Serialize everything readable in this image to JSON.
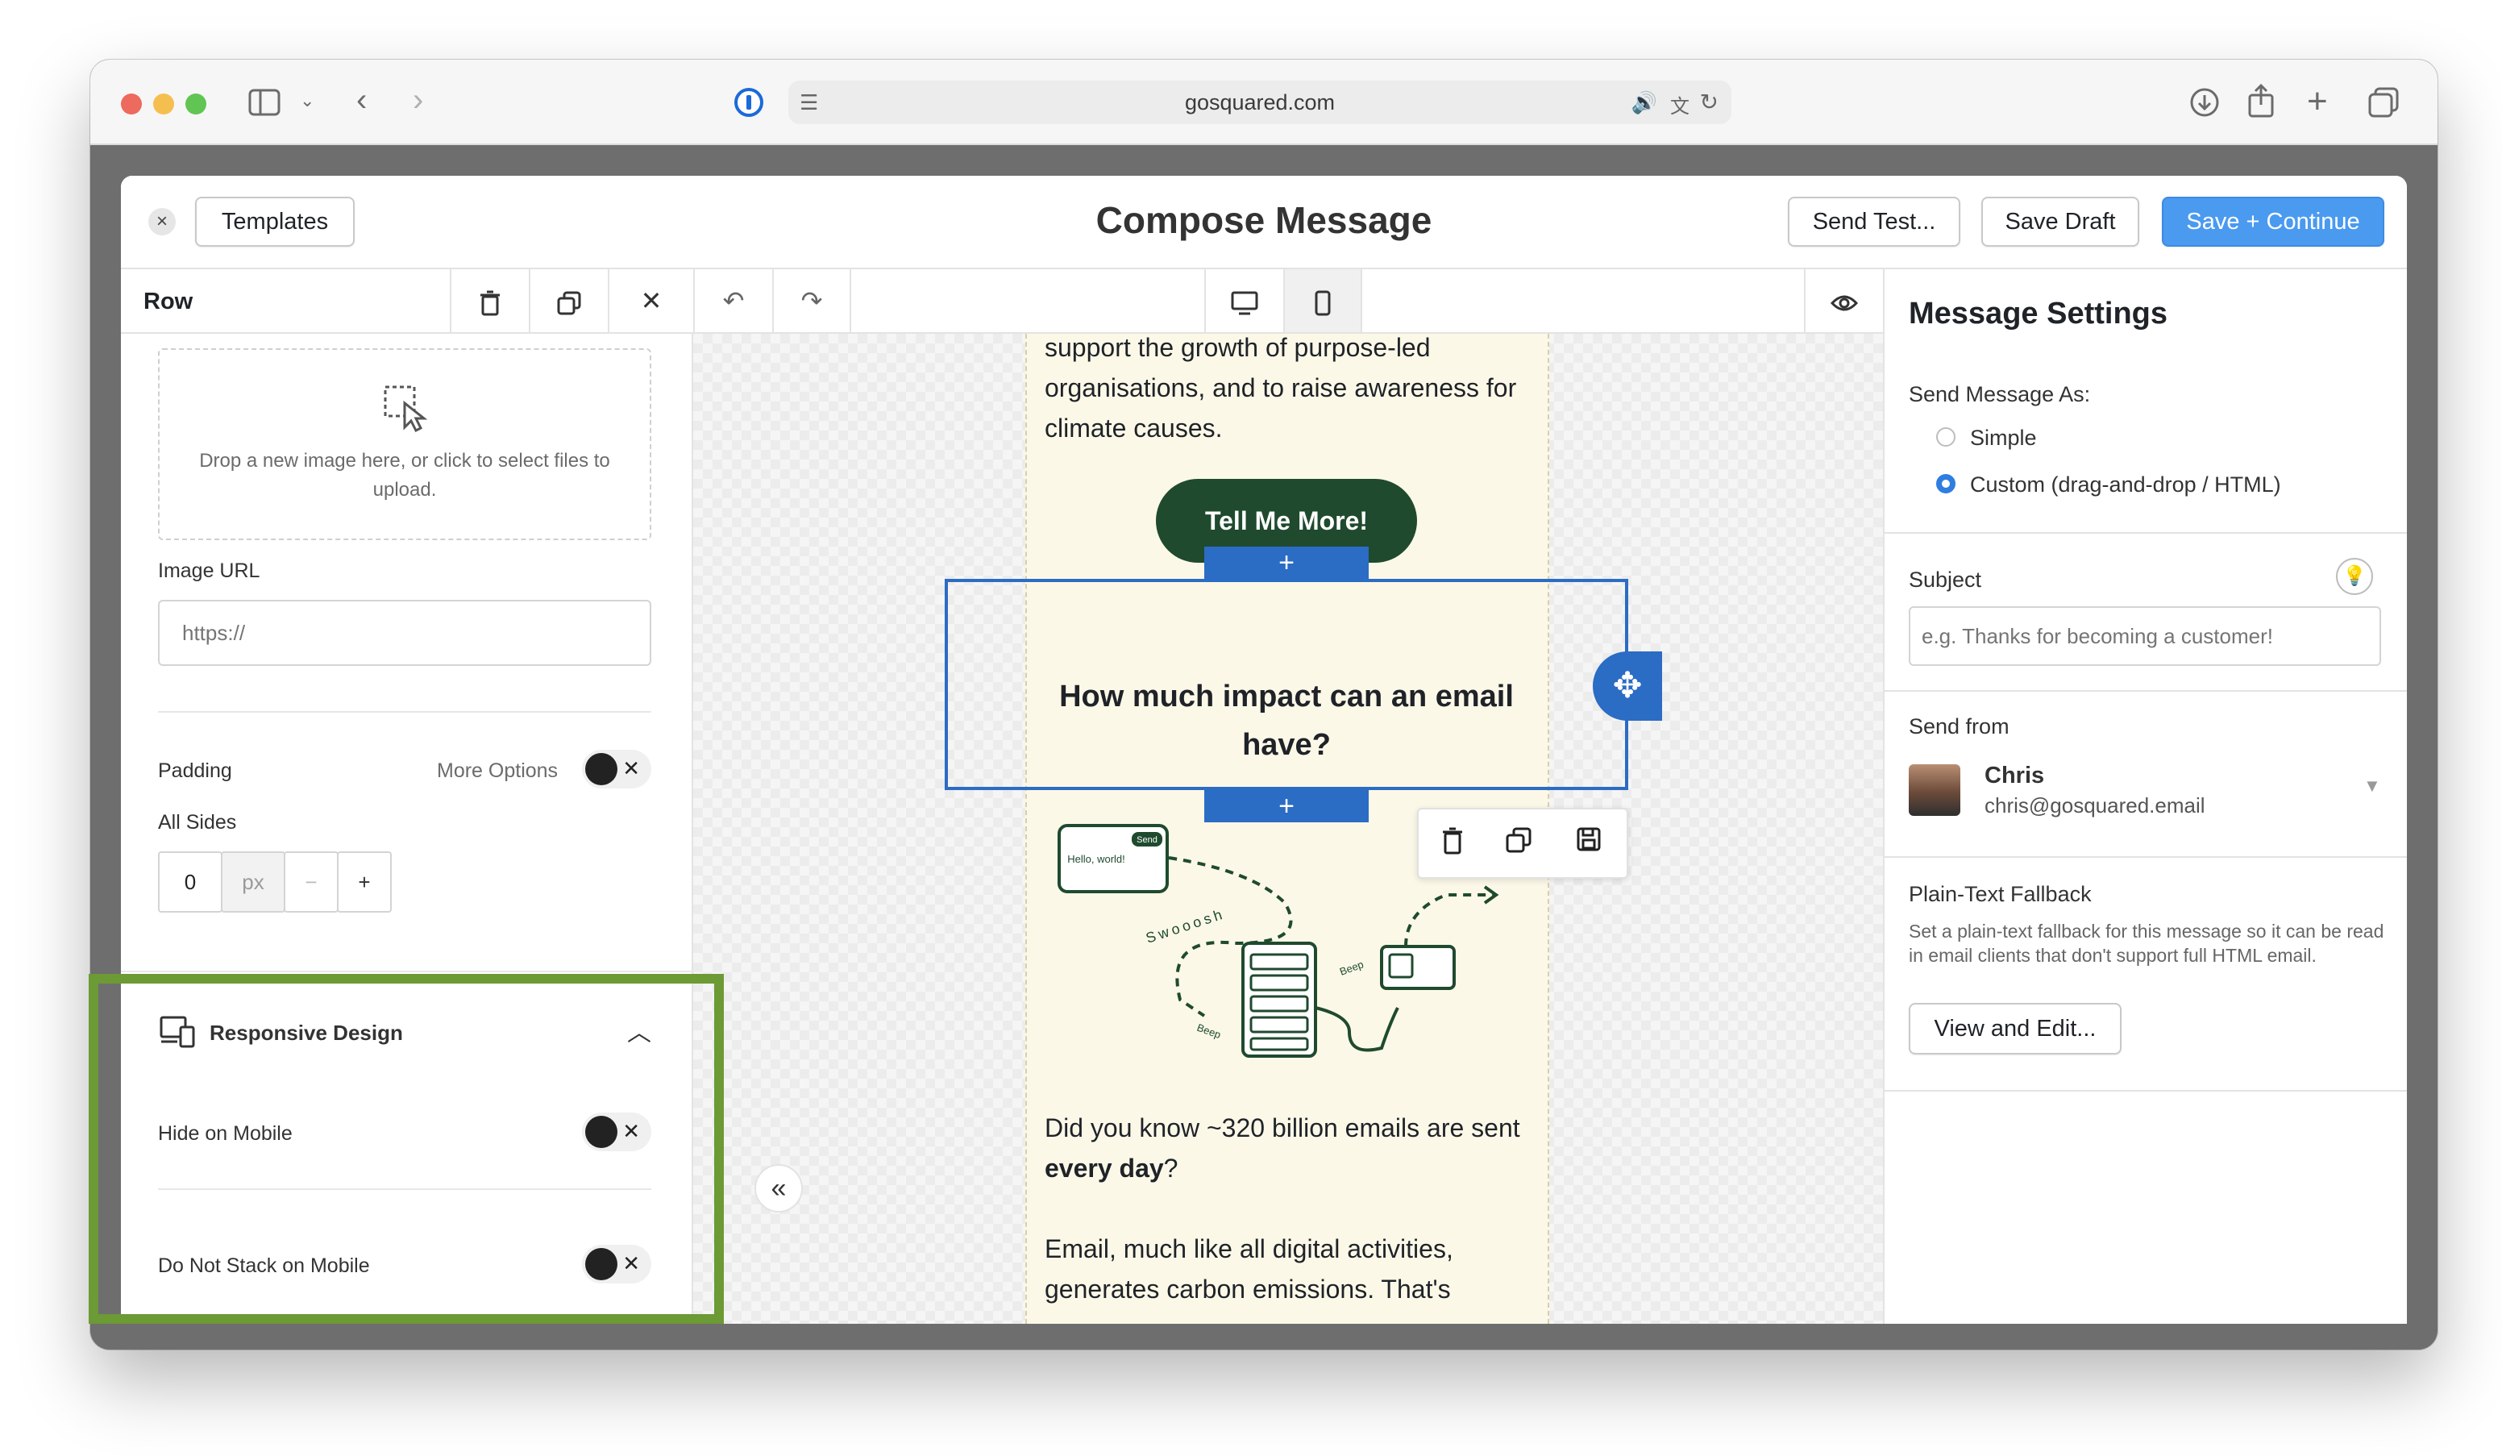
{
  "browser": {
    "url": "gosquared.com",
    "traffic_colors": {
      "close": "#ed6a5e",
      "minimize": "#f5bf4f",
      "zoom": "#61c554"
    }
  },
  "modal": {
    "title": "Compose Message",
    "templates_label": "Templates",
    "send_test_label": "Send Test...",
    "save_draft_label": "Save Draft",
    "save_continue_label": "Save + Continue"
  },
  "toolbar": {
    "row_label": "Row"
  },
  "left_panel": {
    "dropzone_text": "Drop a new image here, or click to select files to upload.",
    "image_url_label": "Image URL",
    "image_url_placeholder": "https://",
    "padding_label": "Padding",
    "more_options_label": "More Options",
    "all_sides_label": "All Sides",
    "padding_value": "0",
    "padding_unit": "px",
    "minus": "−",
    "plus": "+",
    "responsive_title": "Responsive Design",
    "hide_on_mobile_label": "Hide on Mobile",
    "do_not_stack_label": "Do Not Stack on Mobile"
  },
  "email": {
    "intro_text": "support the growth of purpose-led organisations, and to raise awareness for climate causes.",
    "cta_label": "Tell Me More!",
    "heading": "How much impact can an email have?",
    "illus_send": "Send",
    "illus_hello": "Hello, world!",
    "illus_whoosh": "Swooosh",
    "illus_beep1": "Beep",
    "illus_beep2": "Beep",
    "body_line1_start": "Did you know ~320 billion emails are sent ",
    "body_line1_bold": "every day",
    "body_line1_end": "?",
    "body_line2": "Email, much like all digital activities, generates carbon emissions. That's",
    "accent_green": "#1f4a2e",
    "selection_blue": "#2b6cc4"
  },
  "right_panel": {
    "title": "Message Settings",
    "send_as_label": "Send Message As:",
    "option_simple": "Simple",
    "option_custom": "Custom (drag-and-drop / HTML)",
    "subject_label": "Subject",
    "subject_placeholder": "e.g. Thanks for becoming a customer!",
    "send_from_label": "Send from",
    "sender_name": "Chris",
    "sender_email": "chris@gosquared.email",
    "fallback_label": "Plain-Text Fallback",
    "fallback_desc": "Set a plain-text fallback for this message so it can be read in email clients that don't support full HTML email.",
    "view_edit_label": "View and Edit..."
  },
  "highlight_color": "#6c9a35"
}
